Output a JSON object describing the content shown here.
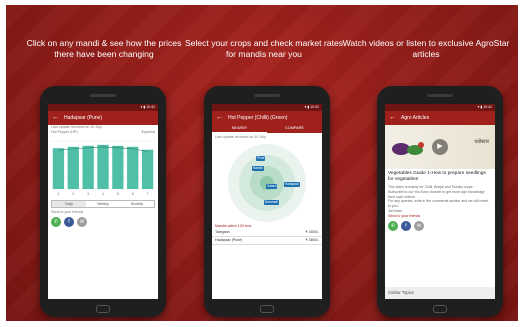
{
  "captions": [
    "Click on any mandi & see how the prices there have been changing",
    "Select your crops and check market rates for mandis near you",
    "Watch videos or listen to exclusive AgroStar articles"
  ],
  "phone1": {
    "title": "Hadapsar (Pune)",
    "updated": "Last update received on 10 July",
    "crop": "Hot Pepper (HP)",
    "price_unit": "₹/quintal",
    "chart_data": {
      "type": "bar",
      "categories": [
        "1",
        "2",
        "3",
        "4",
        "5",
        "6",
        "7"
      ],
      "values": [
        85,
        88,
        90,
        92,
        90,
        88,
        82
      ],
      "ylim": [
        0,
        100
      ]
    },
    "segments": [
      "Daily",
      "Weekly",
      "Monthly"
    ],
    "share_label": "Send to your friends"
  },
  "phone2": {
    "title": "Hot Pepper (Chilli) (Green)",
    "tabs": [
      "NEARBY",
      "COMPARE"
    ],
    "updated": "Last update received on 10 July",
    "pins": [
      "Pune",
      "Nashik",
      "Satara",
      "Hadapsar",
      "Baramati"
    ],
    "list_header": "Mandis within 100 kms",
    "rows": [
      {
        "name": "Talegaon",
        "price": "₹ 4000/-"
      },
      {
        "name": "Hadapsar (Pune)",
        "price": "₹ 3800/-"
      }
    ]
  },
  "phone3": {
    "title": "Agro Articles",
    "hero_text": "एग्रोस्टार",
    "article_title": "Vegetables Guide 1-How to prepare seedlings for vegetables",
    "article_lines": [
      "This video is mainly for Chilli, Brinjal and Tomato crops.",
      "Subscribe to our YouTube channel to get more agri knowledge from such videos.",
      "For any queries, write in the comments section and we will revert to you.",
      "Jai Kisan"
    ],
    "share_label": "Send to your friends",
    "similar": "Similar Topics"
  }
}
